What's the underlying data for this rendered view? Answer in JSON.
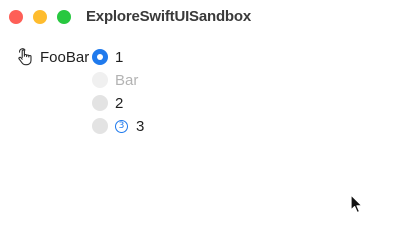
{
  "window": {
    "title": "ExploreSwiftUISandbox",
    "controls": {
      "close_color": "#fe5f57",
      "minimize_color": "#febc2e",
      "zoom_color": "#28c840"
    }
  },
  "form": {
    "label": "FooBar",
    "label_icon": "hand-pointer-icon",
    "accent_color": "#1f7aed",
    "options": [
      {
        "label": "1",
        "selected": true,
        "disabled": false
      },
      {
        "label": "Bar",
        "selected": false,
        "disabled": true
      },
      {
        "label": "2",
        "selected": false,
        "disabled": false
      },
      {
        "label": "3",
        "selected": false,
        "disabled": false,
        "badge": "3",
        "badge_icon": "circled-number-icon"
      }
    ]
  },
  "pointer": {
    "icon": "arrow-cursor-icon"
  }
}
